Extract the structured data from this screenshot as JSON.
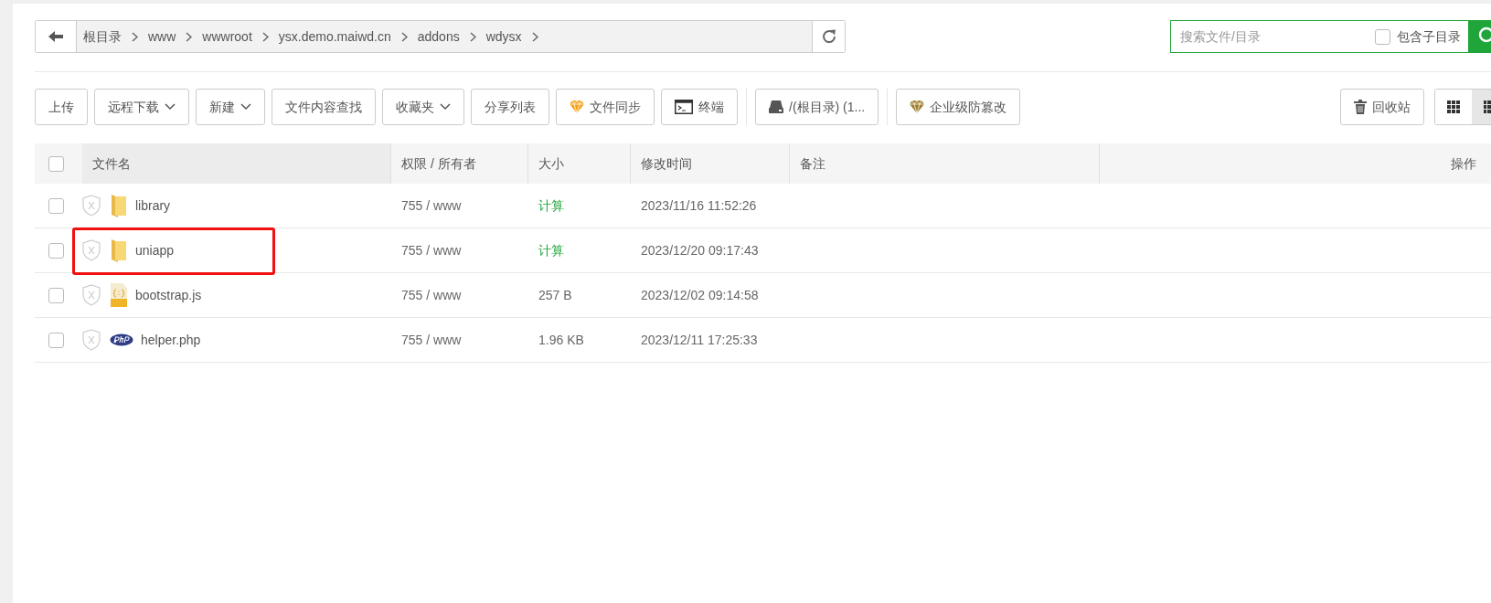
{
  "path_bar": {
    "crumbs": [
      "根目录",
      "www",
      "wwwroot",
      "ysx.demo.maiwd.cn",
      "addons",
      "wdysx"
    ]
  },
  "search": {
    "placeholder": "搜索文件/目录",
    "include_subdirs": {
      "label": "包含子目录",
      "checked": false
    }
  },
  "toolbar": [
    {
      "label": "上传",
      "kind": "plain"
    },
    {
      "label": "远程下载",
      "kind": "dropdown"
    },
    {
      "label": "新建",
      "kind": "dropdown"
    },
    {
      "label": "文件内容查找",
      "kind": "plain"
    },
    {
      "label": "收藏夹",
      "kind": "dropdown"
    },
    {
      "label": "分享列表",
      "kind": "plain"
    },
    {
      "label": "文件同步",
      "kind": "gem",
      "color": "#f7a21b"
    },
    {
      "label": "终端",
      "kind": "terminal"
    },
    {
      "label": "/(根目录) (1...",
      "kind": "disk"
    },
    {
      "label": "企业级防篡改",
      "kind": "gem",
      "color": "#a07c2c"
    }
  ],
  "recycle_button": {
    "label": "回收站"
  },
  "view_toggle": [
    {
      "kind": "grid",
      "selected": false
    },
    {
      "kind": "list",
      "selected": true
    }
  ],
  "table": {
    "select_all_checked": false,
    "columns": [
      "文件名",
      "权限 / 所有者",
      "大小",
      "修改时间",
      "备注",
      "操作"
    ],
    "rows": [
      {
        "checked": false,
        "kind": "folder",
        "name": "library",
        "permissions": "755 / www",
        "size": "计算",
        "size_is_link": true,
        "modified": "2023/11/16 11:52:26",
        "highlighted": false
      },
      {
        "checked": false,
        "kind": "folder",
        "name": "uniapp",
        "permissions": "755 / www",
        "size": "计算",
        "size_is_link": true,
        "modified": "2023/12/20 09:17:43",
        "highlighted": true
      },
      {
        "checked": false,
        "kind": "js",
        "name": "bootstrap.js",
        "permissions": "755 / www",
        "size": "257 B",
        "size_is_link": false,
        "modified": "2023/12/02 09:14:58",
        "highlighted": false
      },
      {
        "checked": false,
        "kind": "php",
        "name": "helper.php",
        "permissions": "755 / www",
        "size": "1.96 KB",
        "size_is_link": false,
        "modified": "2023/12/11 17:25:33",
        "highlighted": false
      }
    ]
  }
}
